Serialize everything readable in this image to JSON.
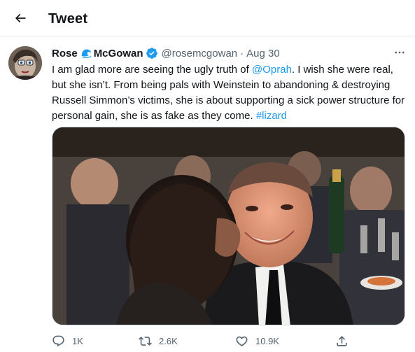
{
  "header": {
    "back_icon": "arrow-left-icon",
    "title": "Tweet"
  },
  "tweet": {
    "author": {
      "name_first": "Rose",
      "name_emoji": "wave-emoji",
      "name_last": "McGowan",
      "verified_icon": "verified-badge-icon",
      "handle": "@rosemcgowan",
      "separator": "·",
      "date": "Aug 30"
    },
    "more_icon": "more-horizontal-icon",
    "text": {
      "part1": "I am glad more are seeing the ugly  truth of ",
      "mention": "@Oprah",
      "part2": ". I wish she were real, but she isn’t. From being pals with Weinstein to abandoning & destroying Russell Simmon’s victims, she is about supporting a sick power structure for personal gain, she is as fake as they come. ",
      "hashtag": "#lizard"
    },
    "media": {
      "icon": "photo-image"
    },
    "actions": {
      "reply": {
        "icon": "reply-icon",
        "count": "1K"
      },
      "retweet": {
        "icon": "retweet-icon",
        "count": "2.6K"
      },
      "like": {
        "icon": "heart-icon",
        "count": "10.9K"
      },
      "share": {
        "icon": "share-icon"
      }
    }
  },
  "colors": {
    "accent": "#1d9bf0",
    "text_primary": "#0f1419",
    "text_secondary": "#536471",
    "border": "#eff3f4"
  }
}
